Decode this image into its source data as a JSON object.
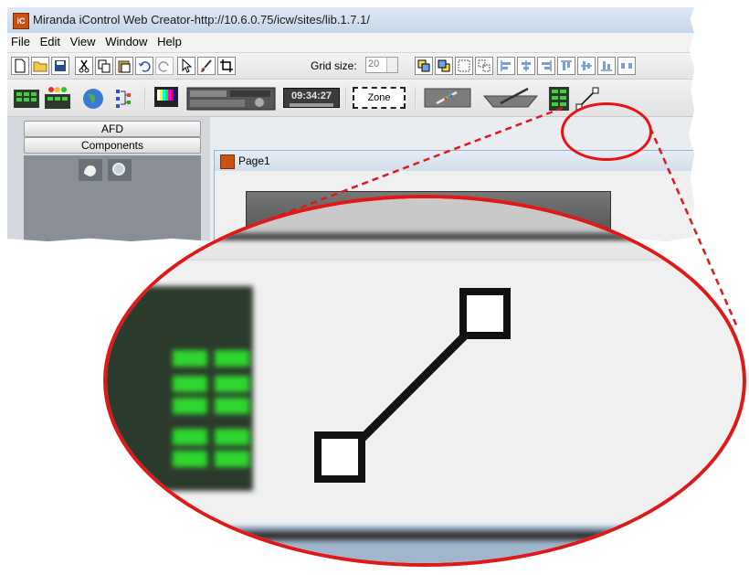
{
  "window": {
    "title": "Miranda iControl Web Creator-http://10.6.0.75/icw/sites/lib.1.7.1/",
    "app_icon_label": "iC"
  },
  "menu": [
    "File",
    "Edit",
    "View",
    "Window",
    "Help"
  ],
  "toolbar": {
    "grid_label": "Grid size:",
    "grid_value": "20"
  },
  "components_bar": {
    "clock_text": "09:34:27",
    "zone_label": "Zone"
  },
  "left_panel": {
    "afd_label": "AFD",
    "components_label": "Components"
  },
  "document": {
    "tab_title": "Page1"
  },
  "colors": {
    "callout": "#e01818",
    "green_led": "#2fd62f"
  }
}
